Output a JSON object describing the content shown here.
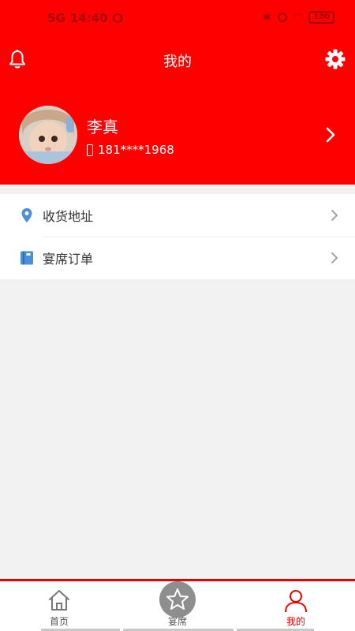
{
  "status_bar": {
    "network": "5G",
    "time": "14:40",
    "battery": "100"
  },
  "header": {
    "title": "我的"
  },
  "profile": {
    "name": "李真",
    "phone": "181****1968"
  },
  "menu": {
    "items": [
      {
        "label": "收货地址",
        "icon": "location-pin-icon"
      },
      {
        "label": "宴席订单",
        "icon": "book-icon"
      }
    ]
  },
  "tabs": [
    {
      "label": "首页",
      "icon": "home-icon"
    },
    {
      "label": "宴席",
      "icon": "star-icon"
    },
    {
      "label": "我的",
      "icon": "user-icon",
      "active": true
    }
  ],
  "colors": {
    "brand_red": "#fe0000",
    "tab_active": "#e60000",
    "menu_icon_blue": "#4a90d9"
  }
}
